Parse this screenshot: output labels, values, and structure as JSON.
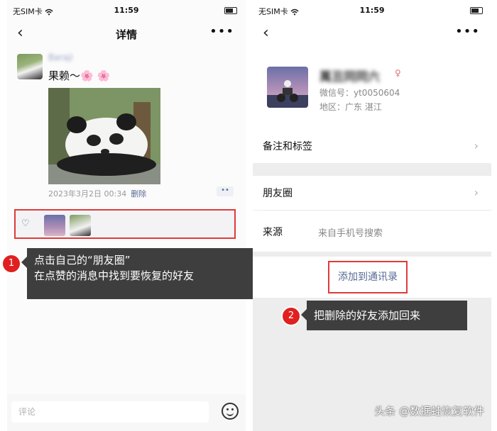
{
  "left": {
    "status": {
      "carrier": "无SIM卡",
      "time": "11:59"
    },
    "nav": {
      "back": "‹",
      "title": "详情",
      "more": "•••"
    },
    "post": {
      "author": "Baraji",
      "text": "果赖～🌸 🌸",
      "date": "2023年3月2日 00:34",
      "delete_label": "删除",
      "more_label": "••"
    },
    "comment": {
      "placeholder": "评论"
    },
    "callout": {
      "badge": "1",
      "line1": "点击自己的“朋友圈”",
      "line2": "在点赞的消息中找到要恢复的好友"
    }
  },
  "right": {
    "status": {
      "carrier": "无SIM卡",
      "time": "11:59"
    },
    "nav": {
      "back": "‹",
      "more": "•••"
    },
    "profile": {
      "nickname": "萬丑同同六",
      "wechat_id": "微信号：yt0050604",
      "region": "地区：广东 湛江"
    },
    "cells": {
      "remark": "备注和标签",
      "moments": "朋友圈",
      "source_label": "来源",
      "source_value": "来自手机号搜索"
    },
    "add_button": "添加到通讯录",
    "callout": {
      "badge": "2",
      "text": "把删除的好友添加回来"
    }
  },
  "watermark": "头条 @数据蛙恢复软件",
  "colors": {
    "highlight": "#e03a3a",
    "link": "#576b95",
    "callout_bg": "#3e3e3e",
    "badge": "#e02020"
  }
}
